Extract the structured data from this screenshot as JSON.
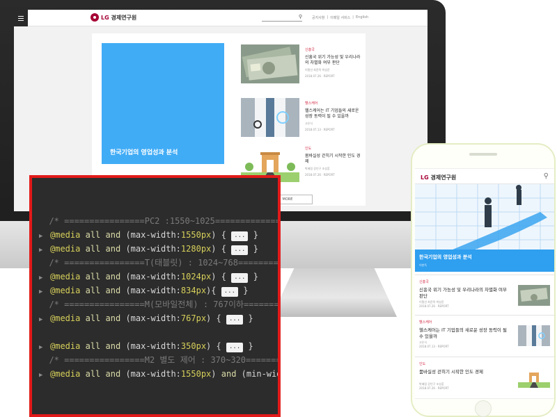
{
  "desktop": {
    "brand": {
      "prefix": "LG",
      "name": "경제연구원"
    },
    "top_links": [
      "공지사항",
      "|",
      "이메일 서비스",
      "|",
      "English"
    ],
    "feature": {
      "title": "한국기업의 영업성과 분석"
    },
    "articles": [
      {
        "category": "신흥국",
        "title": "신흥국 위기 가능성 및 우리나라의 차별화 여부 판단",
        "author": "이철선 최윤락 박성준",
        "meta": "2018.07.26  ·  REPORT"
      },
      {
        "category": "헬스케어",
        "title": "헬스케어는 IT 기업들의 새로운 성장 동력이 될 수 있을까",
        "author": "고은식",
        "meta": "2018.07.13  ·  REPORT"
      },
      {
        "category": "인도",
        "title": "뭄바실성 걷히기 시작한 인도 경제",
        "author": "박혜림 강인구 조성훈",
        "meta": "2018.07.26  ·  REPORT"
      }
    ],
    "more_label": "MORE"
  },
  "code": {
    "lines": [
      {
        "type": "comment",
        "text": "/* ================PC2 :1550~1025================ */"
      },
      {
        "type": "rule",
        "at": "@media",
        "kw1": "all",
        "kw2": "and",
        "pre": "(max-width:",
        "num": "1550px",
        "post": ")",
        "ellipsis": "...",
        "tail": "}"
      },
      {
        "type": "rule",
        "at": "@media",
        "kw1": "all",
        "kw2": "and",
        "pre": "(max-width:",
        "num": "1280px",
        "post": ")",
        "ellipsis": "...",
        "tail": "}"
      },
      {
        "type": "comment",
        "text": "/* ================T(태블릿) : 1024~768================ */"
      },
      {
        "type": "rule",
        "at": "@media",
        "kw1": "all",
        "kw2": "and",
        "pre": "(max-width:",
        "num": "1024px",
        "post": ")",
        "ellipsis": "...",
        "tail": "}"
      },
      {
        "type": "rule",
        "at": "@media",
        "kw1": "all",
        "kw2": "and",
        "pre": "(max-width:",
        "num": "834px",
        "post": ")",
        "ellipsis": "...",
        "tail": "}"
      },
      {
        "type": "comment",
        "text": "/* ================M(모바일전체) : 767이하================ */"
      },
      {
        "type": "rule",
        "at": "@media",
        "kw1": "all",
        "kw2": "and",
        "pre": "(max-width:",
        "num": "767px",
        "post": ")",
        "ellipsis": "...",
        "tail": "}"
      },
      {
        "type": "blank",
        "text": ""
      },
      {
        "type": "rule",
        "at": "@media",
        "kw1": "all",
        "kw2": "and",
        "pre": "(max-width:",
        "num": "350px",
        "post": ")",
        "ellipsis": "...",
        "tail": "}"
      },
      {
        "type": "comment",
        "text": "/* ================M2 별도 제어 : 370~320================ */"
      },
      {
        "type": "rule2",
        "at": "@media",
        "kw1": "all",
        "kw2": "and",
        "pre": "(max-width:",
        "num": "1550px",
        "post": ")",
        "kw3": "and",
        "pre2": "(min-width:",
        "num2": "320px",
        "post2": ")"
      }
    ]
  },
  "mobile": {
    "brand": {
      "prefix": "LG",
      "name": "경제연구원"
    },
    "search_icon": "search-icon",
    "feature": {
      "title": "한국기업의 영업성과 분석",
      "author": "이한득"
    },
    "articles": [
      {
        "category": "신흥국",
        "title": "신흥국 위기 가능성 및 우리나라의 차별화 여부 판단",
        "meta": "이철선 최윤락 박성준\n2018.07.26 · REPORT"
      },
      {
        "category": "헬스케어",
        "title": "헬스케어는 IT 기업들의 새로운 성장 동력이 될 수 있을까",
        "meta": "고은식\n2018.07.13 · REPORT"
      },
      {
        "category": "인도",
        "title": "뭄바실성 걷히기 시작한 인도 경제",
        "meta": "박혜림 강인구 조성훈\n2018.07.26 · REPORT"
      }
    ]
  },
  "colors": {
    "brand_red": "#a50034",
    "feature_blue": "#41acf6",
    "highlight_border": "#e21a1a",
    "code_bg": "#2c2c2c"
  }
}
